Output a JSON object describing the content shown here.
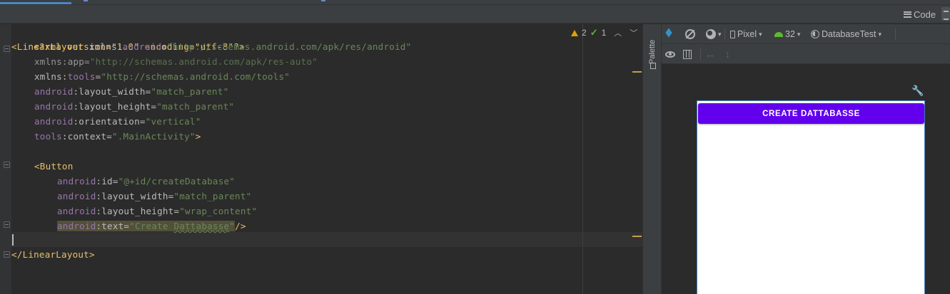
{
  "mode_bar": {
    "code_label": "Code"
  },
  "inspections": {
    "warnings": "2",
    "checks": "1"
  },
  "editor": {
    "lines": [
      {
        "decl": "<?xml version=\"1.0\" encoding=\"utf-8\"?>"
      },
      {
        "tag_open": "<LinearLayout",
        "attr": " xmlns:",
        "ns": "android",
        "eq": "=",
        "val": "\"http://schemas.android.com/apk/res/android\""
      },
      {
        "attr": "xmlns:app=",
        "val": "\"http://schemas.android.com/apk/res-auto\""
      },
      {
        "attr_a": "xmlns:",
        "ns": "tools",
        "eq": "=",
        "val": "\"http://schemas.android.com/tools\""
      },
      {
        "ns": "android",
        "attr": ":layout_width=",
        "val": "\"match_parent\""
      },
      {
        "ns": "android",
        "attr": ":layout_height=",
        "val": "\"match_parent\""
      },
      {
        "ns": "android",
        "attr": ":orientation=",
        "val": "\"vertical\""
      },
      {
        "ns": "tools",
        "attr": ":context=",
        "val": "\".MainActivity\"",
        "close": ">"
      },
      {
        "empty": ""
      },
      {
        "tag_open": "<Button"
      },
      {
        "ns": "android",
        "attr": ":id=",
        "val": "\"@+id/createDatabase\""
      },
      {
        "ns": "android",
        "attr": ":layout_width=",
        "val": "\"match_parent\""
      },
      {
        "ns": "android",
        "attr": ":layout_height=",
        "val": "\"wrap_content\""
      },
      {
        "ns": "android",
        "attr": ":text=",
        "val_q1": "\"Create ",
        "val_under": "Dattabasse",
        "val_q2": "\"",
        "close": "/>"
      },
      {
        "empty": ""
      },
      {
        "tag_close": "</LinearLayout>"
      }
    ]
  },
  "palette": {
    "label": "Palette"
  },
  "design_toolbar": {
    "device": "Pixel",
    "api": "32",
    "theme": "DatabaseTest"
  },
  "preview": {
    "button_text": "CREATE DATTABASSE"
  },
  "colors": {
    "button": "#6200ee",
    "editor_bg": "#2b2b2b"
  }
}
